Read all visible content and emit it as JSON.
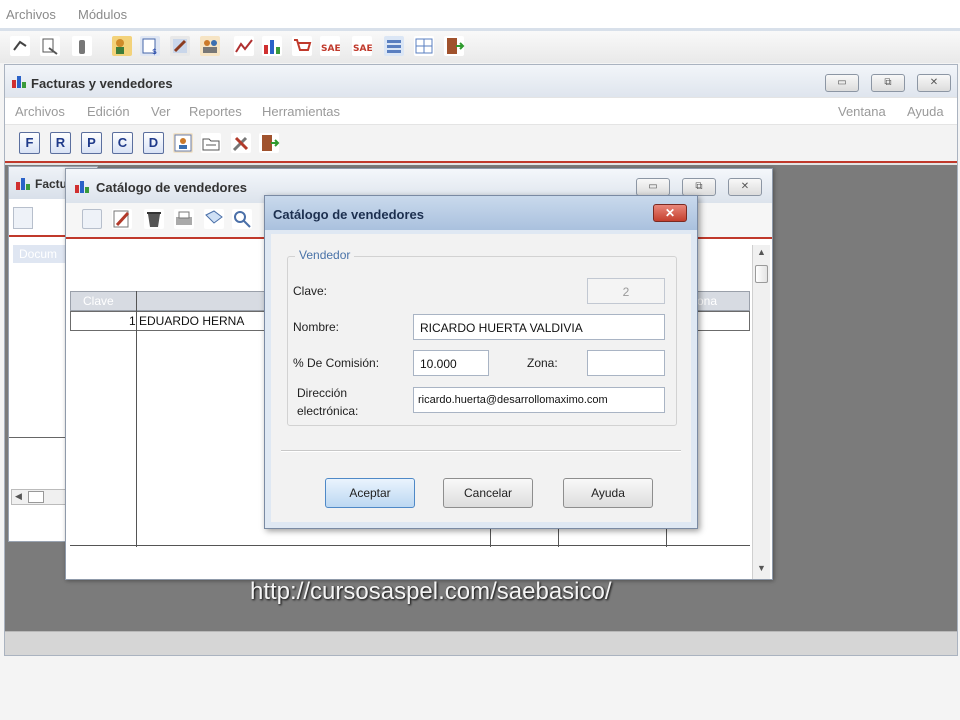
{
  "app_menu": [
    "Archivos",
    "Módulos"
  ],
  "app_toolbar": {
    "icons": [
      "connect-icon",
      "report-icon",
      "tool-icon",
      "sellers-icon",
      "catalog-icon",
      "edit-icon",
      "users-icon",
      "stats-icon",
      "bar-chart-icon",
      "cart-icon",
      "sae-icon",
      "sae-alt-icon",
      "list-icon",
      "grid-icon",
      "exit-icon"
    ]
  },
  "facturas_window": {
    "title": "Facturas y vendedores",
    "menu_left": [
      "Archivos",
      "Edición",
      "Ver",
      "Reportes",
      "Herramientas"
    ],
    "menu_right": [
      "Ventana",
      "Ayuda"
    ],
    "toolbar_letters": [
      "F",
      "R",
      "P",
      "C",
      "D"
    ],
    "window_controls": {
      "minimize": "▭",
      "restore": "⧉",
      "close": "✕"
    }
  },
  "left_window": {
    "title": "Factu",
    "tab_label": "Docum"
  },
  "catalog_window": {
    "title": "Catálogo de vendedores",
    "grid": {
      "headers": [
        "Clave",
        "",
        "ona"
      ],
      "rows": [
        {
          "clave": "1",
          "nombre": "EDUARDO HERNA"
        }
      ]
    }
  },
  "dialog": {
    "title": "Catálogo de vendedores",
    "close": "✕",
    "group_label": "Vendedor",
    "fields": {
      "clave": {
        "label": "Clave:",
        "value": "2"
      },
      "nombre": {
        "label": "Nombre:",
        "value": "RICARDO HUERTA VALDIVIA"
      },
      "comision": {
        "label": "% De Comisión:",
        "value": "10.000"
      },
      "zona": {
        "label": "Zona:",
        "value": ""
      },
      "email": {
        "label_line1": "Dirección",
        "label_line2": "electrónica:",
        "value": "ricardo.huerta@desarrollomaximo.com"
      }
    },
    "buttons": {
      "accept": "Aceptar",
      "cancel": "Cancelar",
      "help": "Ayuda"
    }
  },
  "watermark": "http://cursosaspel.com/saebasico/",
  "colors": {
    "accent_red": "#c0392b",
    "title_blue": "#aac1de",
    "workspace": "#7b7b7b"
  }
}
